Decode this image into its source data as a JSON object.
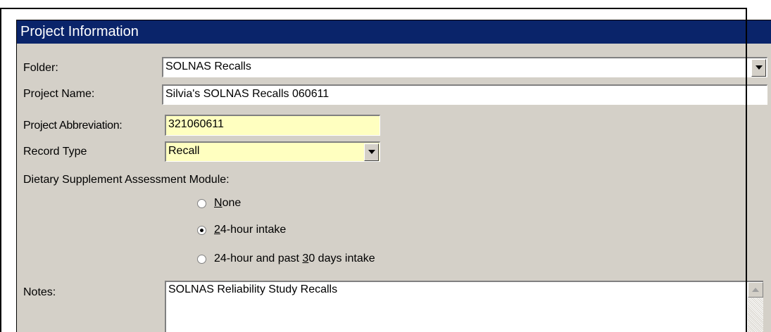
{
  "title": "Project Information",
  "folder": {
    "label": "Folder:",
    "value": "SOLNAS Recalls"
  },
  "project_name": {
    "label": "Project Name:",
    "value": "Silvia's SOLNAS Recalls 060611"
  },
  "project_abbreviation": {
    "label": "Project Abbreviation:",
    "value": "321060611"
  },
  "record_type": {
    "label": "Record Type",
    "value": "Recall"
  },
  "dietary_module": {
    "label": "Dietary Supplement Assessment Module:",
    "options": [
      {
        "label_pre": "",
        "label_ul": "N",
        "label_post": "one",
        "checked": false
      },
      {
        "label_pre": "",
        "label_ul": "2",
        "label_post": "4-hour intake",
        "checked": true
      },
      {
        "label_pre": "24-hour and past ",
        "label_ul": "3",
        "label_post": "0 days intake",
        "checked": false
      }
    ]
  },
  "notes": {
    "label": "Notes:",
    "value": "SOLNAS Reliability Study Recalls"
  },
  "colors": {
    "title_bar": "#0a246a",
    "panel": "#d4d0c8",
    "highlight_field": "#ffffc0"
  }
}
